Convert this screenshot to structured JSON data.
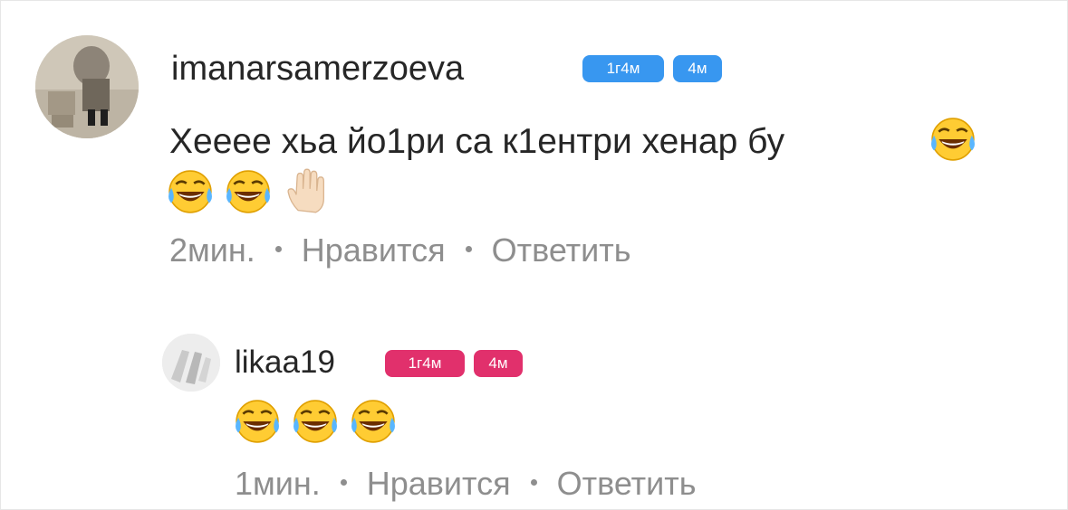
{
  "comments": [
    {
      "username": "imanarsamerzoeva",
      "badges": [
        {
          "text": "1г4м",
          "color": "#3897f0"
        },
        {
          "text": "4м",
          "color": "#3897f0"
        }
      ],
      "text": "Хееее хьа йо1ри са к1ентри хенар бу",
      "emojis": [
        "face-with-tears-of-joy",
        "face-with-tears-of-joy",
        "face-with-tears-of-joy",
        "raised-hand-light-skin"
      ],
      "time": "2мин.",
      "like_label": "Нравится",
      "reply_label": "Ответить"
    },
    {
      "username": "likaa19",
      "badges": [
        {
          "text": "1г4м",
          "color": "#e1306c"
        },
        {
          "text": "4м",
          "color": "#e1306c"
        }
      ],
      "text": "",
      "emojis": [
        "face-with-tears-of-joy",
        "face-with-tears-of-joy",
        "face-with-tears-of-joy"
      ],
      "time": "1мин.",
      "like_label": "Нравится",
      "reply_label": "Ответить"
    }
  ]
}
